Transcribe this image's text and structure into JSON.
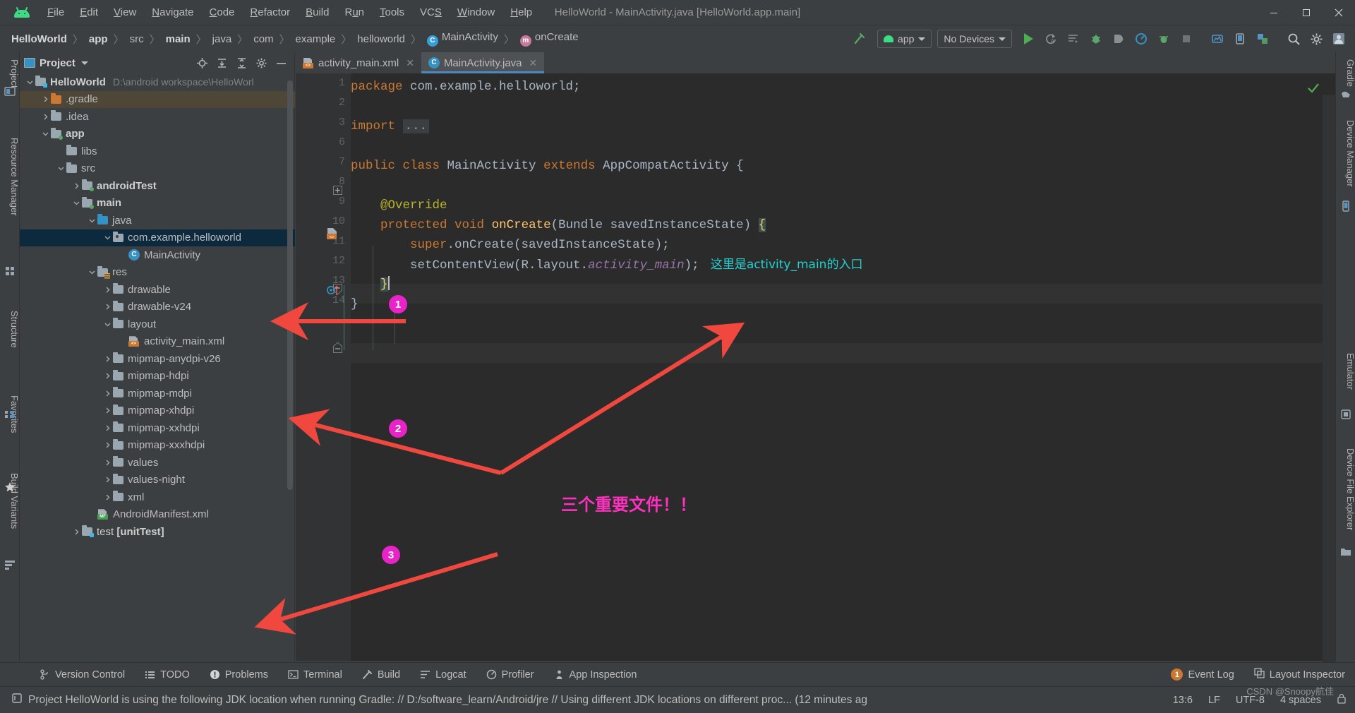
{
  "window": {
    "title": "HelloWorld - MainActivity.java [HelloWorld.app.main]",
    "minimize": "–",
    "maximize": "□",
    "close": "✕"
  },
  "menubar": {
    "items": [
      {
        "label": "File",
        "mnemonic": "F"
      },
      {
        "label": "Edit",
        "mnemonic": "E"
      },
      {
        "label": "View",
        "mnemonic": "V"
      },
      {
        "label": "Navigate",
        "mnemonic": "N"
      },
      {
        "label": "Code",
        "mnemonic": "C"
      },
      {
        "label": "Refactor",
        "mnemonic": "R"
      },
      {
        "label": "Build",
        "mnemonic": "B"
      },
      {
        "label": "Run",
        "mnemonic": "u"
      },
      {
        "label": "Tools",
        "mnemonic": "T"
      },
      {
        "label": "VCS",
        "mnemonic": "S"
      },
      {
        "label": "Window",
        "mnemonic": "W"
      },
      {
        "label": "Help",
        "mnemonic": "H"
      }
    ]
  },
  "breadcrumbs": [
    {
      "label": "HelloWorld",
      "bold": true,
      "icon": null
    },
    {
      "label": "app",
      "bold": true,
      "icon": null
    },
    {
      "label": "src",
      "bold": false,
      "icon": null
    },
    {
      "label": "main",
      "bold": true,
      "icon": null
    },
    {
      "label": "java",
      "bold": false,
      "icon": null
    },
    {
      "label": "com",
      "bold": false,
      "icon": null
    },
    {
      "label": "example",
      "bold": false,
      "icon": null
    },
    {
      "label": "helloworld",
      "bold": false,
      "icon": null
    },
    {
      "label": "MainActivity",
      "bold": false,
      "icon": "class-icon"
    },
    {
      "label": "onCreate",
      "bold": false,
      "icon": "method-icon"
    }
  ],
  "toolbar": {
    "build_icon": "build-hammer-icon",
    "run_config": "app",
    "device_selector": "No Devices",
    "run_label": "run-button",
    "icons": [
      "run-icon",
      "apply-changes-icon",
      "apply-code-changes-icon",
      "debug-icon",
      "attach-debugger-icon",
      "profiler-icon",
      "avd-manager-icon",
      "stop-icon",
      "sdk-manager-icon",
      "device-manager-icon",
      "layout-inspector-icon",
      "search-icon",
      "settings-gear-icon",
      "user-avatar-icon"
    ]
  },
  "left_strip": {
    "tabs": [
      "Project",
      "Resource Manager",
      "Structure",
      "Favorites",
      "Build Variants"
    ]
  },
  "right_strip": {
    "tabs": [
      "Gradle",
      "Device Manager",
      "Emulator",
      "Device File Explorer"
    ]
  },
  "project_panel": {
    "title": "Project",
    "actions": [
      "locate-icon",
      "expand-all-icon",
      "collapse-all-icon",
      "settings-gear-icon",
      "hide-icon"
    ],
    "tree": [
      {
        "depth": 0,
        "label": "HelloWorld",
        "bold": true,
        "chev": "down",
        "icon": "folder-module",
        "path": "D:\\android workspace\\HelloWorl",
        "state": "normal"
      },
      {
        "depth": 1,
        "label": ".gradle",
        "bold": false,
        "chev": "right",
        "icon": "folder-orange",
        "state": "highlighted"
      },
      {
        "depth": 1,
        "label": ".idea",
        "bold": false,
        "chev": "right",
        "icon": "folder",
        "state": "normal"
      },
      {
        "depth": 1,
        "label": "app",
        "bold": true,
        "chev": "down",
        "icon": "folder-module",
        "state": "normal"
      },
      {
        "depth": 2,
        "label": "libs",
        "bold": false,
        "chev": "none",
        "icon": "folder",
        "state": "normal"
      },
      {
        "depth": 2,
        "label": "src",
        "bold": false,
        "chev": "down",
        "icon": "folder",
        "state": "normal"
      },
      {
        "depth": 3,
        "label": "androidTest",
        "bold": true,
        "chev": "right",
        "icon": "folder-module",
        "state": "normal"
      },
      {
        "depth": 3,
        "label": "main",
        "bold": true,
        "chev": "down",
        "icon": "folder-module",
        "state": "normal"
      },
      {
        "depth": 4,
        "label": "java",
        "bold": false,
        "chev": "down",
        "icon": "folder-blue",
        "state": "normal"
      },
      {
        "depth": 5,
        "label": "com.example.helloworld",
        "bold": false,
        "chev": "down",
        "icon": "folder-package",
        "state": "selected"
      },
      {
        "depth": 6,
        "label": "MainActivity",
        "bold": false,
        "chev": "none",
        "icon": "java-class",
        "state": "normal"
      },
      {
        "depth": 4,
        "label": "res",
        "bold": false,
        "chev": "down",
        "icon": "folder-res",
        "state": "normal"
      },
      {
        "depth": 5,
        "label": "drawable",
        "bold": false,
        "chev": "right",
        "icon": "folder",
        "state": "normal"
      },
      {
        "depth": 5,
        "label": "drawable-v24",
        "bold": false,
        "chev": "right",
        "icon": "folder",
        "state": "normal"
      },
      {
        "depth": 5,
        "label": "layout",
        "bold": false,
        "chev": "down",
        "icon": "folder",
        "state": "normal"
      },
      {
        "depth": 6,
        "label": "activity_main.xml",
        "bold": false,
        "chev": "none",
        "icon": "xml-layout",
        "state": "normal"
      },
      {
        "depth": 5,
        "label": "mipmap-anydpi-v26",
        "bold": false,
        "chev": "right",
        "icon": "folder",
        "state": "normal"
      },
      {
        "depth": 5,
        "label": "mipmap-hdpi",
        "bold": false,
        "chev": "right",
        "icon": "folder",
        "state": "normal"
      },
      {
        "depth": 5,
        "label": "mipmap-mdpi",
        "bold": false,
        "chev": "right",
        "icon": "folder",
        "state": "normal"
      },
      {
        "depth": 5,
        "label": "mipmap-xhdpi",
        "bold": false,
        "chev": "right",
        "icon": "folder",
        "state": "normal"
      },
      {
        "depth": 5,
        "label": "mipmap-xxhdpi",
        "bold": false,
        "chev": "right",
        "icon": "folder",
        "state": "normal"
      },
      {
        "depth": 5,
        "label": "mipmap-xxxhdpi",
        "bold": false,
        "chev": "right",
        "icon": "folder",
        "state": "normal"
      },
      {
        "depth": 5,
        "label": "values",
        "bold": false,
        "chev": "right",
        "icon": "folder",
        "state": "normal"
      },
      {
        "depth": 5,
        "label": "values-night",
        "bold": false,
        "chev": "right",
        "icon": "folder",
        "state": "normal"
      },
      {
        "depth": 5,
        "label": "xml",
        "bold": false,
        "chev": "right",
        "icon": "folder",
        "state": "normal"
      },
      {
        "depth": 4,
        "label": "AndroidManifest.xml",
        "bold": false,
        "chev": "none",
        "icon": "xml-manifest",
        "state": "normal"
      },
      {
        "depth": 3,
        "label": "test [unitTest]",
        "bold": true,
        "chev": "right",
        "icon": "folder-module",
        "state": "normal"
      }
    ]
  },
  "editor": {
    "tabs": [
      {
        "label": "activity_main.xml",
        "icon": "xml-layout",
        "active": false
      },
      {
        "label": "MainActivity.java",
        "icon": "java-class",
        "active": true
      }
    ],
    "line_numbers": [
      "1",
      "2",
      "3",
      "6",
      "7",
      "8",
      "9",
      "10",
      "11",
      "12",
      "13",
      "14"
    ],
    "code_lines": [
      {
        "num": "1",
        "segments": [
          {
            "t": "package",
            "c": "kw"
          },
          {
            "t": " com.example.helloworld;",
            "c": ""
          }
        ]
      },
      {
        "num": "2",
        "segments": []
      },
      {
        "num": "3",
        "segments": [
          {
            "t": "import",
            "c": "kw"
          },
          {
            "t": " ",
            "c": ""
          },
          {
            "t": "...",
            "c": "fold"
          }
        ]
      },
      {
        "num": "6",
        "segments": []
      },
      {
        "num": "7",
        "segments": [
          {
            "t": "public class",
            "c": "kw"
          },
          {
            "t": " MainActivity ",
            "c": ""
          },
          {
            "t": "extends",
            "c": "kw"
          },
          {
            "t": " AppCompatActivity {",
            "c": ""
          }
        ]
      },
      {
        "num": "8",
        "segments": []
      },
      {
        "num": "9",
        "segments": [
          {
            "t": "    @Override",
            "c": "ann"
          }
        ]
      },
      {
        "num": "10",
        "segments": [
          {
            "t": "    ",
            "c": ""
          },
          {
            "t": "protected void",
            "c": "kw"
          },
          {
            "t": " ",
            "c": ""
          },
          {
            "t": "onCreate",
            "c": "fn"
          },
          {
            "t": "(Bundle savedInstanceState) ",
            "c": ""
          },
          {
            "t": "{",
            "c": "bracehl"
          }
        ]
      },
      {
        "num": "11",
        "segments": [
          {
            "t": "        ",
            "c": ""
          },
          {
            "t": "super",
            "c": "kw"
          },
          {
            "t": ".onCreate(savedInstanceState);",
            "c": ""
          }
        ]
      },
      {
        "num": "12",
        "segments": [
          {
            "t": "        setContentView(R.layout.",
            "c": ""
          },
          {
            "t": "activity_main",
            "c": "fld"
          },
          {
            "t": ");",
            "c": ""
          }
        ]
      },
      {
        "num": "13",
        "segments": [
          {
            "t": "    ",
            "c": ""
          },
          {
            "t": "}",
            "c": "bracehl"
          }
        ]
      },
      {
        "num": "14",
        "segments": [
          {
            "t": "}",
            "c": ""
          }
        ]
      }
    ],
    "inline_note": "这里是activity_main的入口",
    "inspection_status": "ok-check"
  },
  "annotations": {
    "badges": [
      "1",
      "2",
      "3"
    ],
    "note": "三个重要文件！！"
  },
  "bottom_bar": {
    "items": [
      {
        "label": "Version Control",
        "icon": "branch-icon"
      },
      {
        "label": "TODO",
        "icon": "list-icon"
      },
      {
        "label": "Problems",
        "icon": "exclamation-icon"
      },
      {
        "label": "Terminal",
        "icon": "terminal-icon"
      },
      {
        "label": "Build",
        "icon": "hammer-icon"
      },
      {
        "label": "Logcat",
        "icon": "logcat-icon"
      },
      {
        "label": "Profiler",
        "icon": "profiler-icon"
      },
      {
        "label": "App Inspection",
        "icon": "inspection-icon"
      }
    ],
    "right_items": [
      {
        "label": "Event Log",
        "icon": "event-log-icon",
        "badge": "1"
      },
      {
        "label": "Layout Inspector",
        "icon": "layout-inspector-icon",
        "badge": null
      }
    ]
  },
  "status_bar": {
    "message": "Project HelloWorld is using the following JDK location when running Gradle: // D:/software_learn/Android/jre // Using different JDK locations on different proc... (12 minutes ag",
    "caret_position": "13:6",
    "line_separator": "LF",
    "encoding": "UTF-8",
    "indent": "4 spaces",
    "watermark": "CSDN @Snoopy航佳"
  }
}
